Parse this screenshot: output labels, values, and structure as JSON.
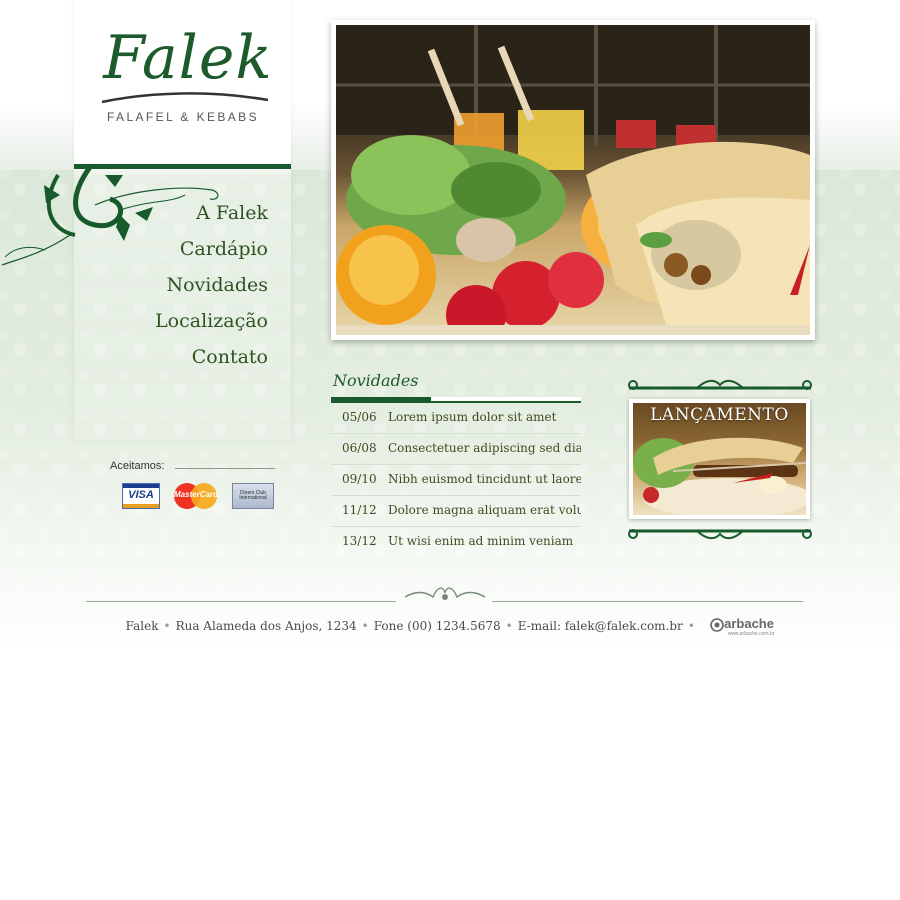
{
  "brand": {
    "name": "Falek",
    "tagline": "FALAFEL & KEBABS"
  },
  "nav": {
    "items": [
      {
        "label": "A Falek"
      },
      {
        "label": "Cardápio"
      },
      {
        "label": "Novidades"
      },
      {
        "label": "Localização"
      },
      {
        "label": "Contato"
      }
    ]
  },
  "payment": {
    "label": "Aceitamos:",
    "cards": [
      {
        "name": "VISA"
      },
      {
        "name": "MasterCard"
      },
      {
        "name": "Diners Club International"
      }
    ]
  },
  "news": {
    "title": "Novidades",
    "items": [
      {
        "date": "05/06",
        "text": "Lorem ipsum dolor sit amet"
      },
      {
        "date": "06/08",
        "text": "Consectetuer adipiscing sed diam"
      },
      {
        "date": "09/10",
        "text": "Nibh euismod tincidunt ut laoreet"
      },
      {
        "date": "11/12",
        "text": "Dolore magna aliquam erat volutpa"
      },
      {
        "date": "13/12",
        "text": "Ut wisi enim ad minim veniam"
      }
    ]
  },
  "promo": {
    "label": "LANÇAMENTO"
  },
  "footer": {
    "name": "Falek",
    "address": "Rua Alameda dos Anjos, 1234",
    "phone": "Fone (00) 1234.5678",
    "email": "E-mail: falek@falek.com.br",
    "credit": "arbache",
    "credit_url": "www.arbache.com.br"
  },
  "colors": {
    "brand_green": "#175a2b",
    "nav_text": "#2d5420",
    "background_green": "#dbe8d9"
  }
}
